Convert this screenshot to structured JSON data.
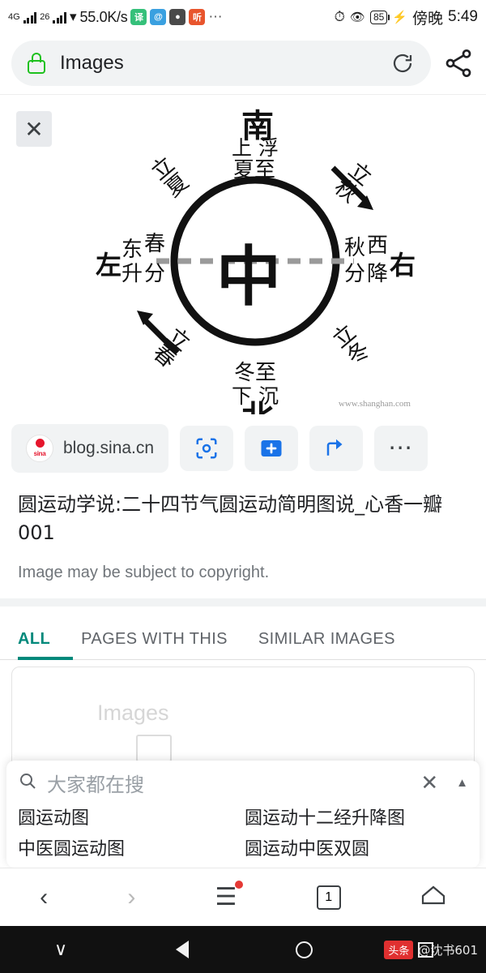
{
  "status_bar": {
    "network_1": "4G",
    "network_2": "26",
    "speed": "55.0K/s",
    "clock": "5:49",
    "clock_prefix": "傍晚",
    "battery": "85",
    "icons": [
      "signal-bars-icon",
      "signal-bars-icon",
      "wifi-icon",
      "app-icon-translate",
      "app-icon-browser",
      "app-icon-chat",
      "app-icon-media",
      "more-icon",
      "timer-icon",
      "eye-icon",
      "battery-icon",
      "charging-icon"
    ]
  },
  "browser": {
    "url_label": "Images",
    "lock_color": "#1ec11e",
    "reload_label": "reload-icon",
    "share_label": "share-icon"
  },
  "image_viewer": {
    "close_label": "✕",
    "watermark": "www.shanghan.com",
    "diagram": {
      "center": "中",
      "top": "南",
      "top_sub1": "上 浮",
      "top_sub2": "夏至",
      "bottom": "北",
      "bottom_sub1": "冬至",
      "bottom_sub2": "下 沉",
      "left": "左",
      "left_sub1": "东",
      "left_sub2": "春",
      "left_sub3": "升",
      "left_sub4": "分",
      "right": "右",
      "right_sub1": "秋",
      "right_sub2": "西",
      "right_sub3": "分",
      "right_sub4": "降",
      "nw": "立夏",
      "ne": "立秋",
      "sw": "立春",
      "se": "立冬"
    }
  },
  "source": {
    "site": "blog.sina.cn",
    "logo_text": "sina",
    "actions": [
      "lens-icon",
      "add-icon",
      "share-icon",
      "more-icon"
    ]
  },
  "caption": {
    "title": "圆运动学说:二十四节气圆运动简明图说_心香一瓣001",
    "copyright": "Image may be subject to copyright."
  },
  "tabs": [
    {
      "label": "ALL",
      "active": true
    },
    {
      "label": "PAGES WITH THIS",
      "active": false
    },
    {
      "label": "SIMILAR IMAGES",
      "active": false
    }
  ],
  "results_placeholder": {
    "ghost_text": "Images"
  },
  "suggestions": {
    "header": "大家都在搜",
    "search_icon": "search-icon",
    "close_icon": "close-icon",
    "caret_icon": "chevron-up-icon",
    "items": [
      "圆运动图",
      "圆运动十二经升降图",
      "中医圆运动图",
      "圆运动中医双圆"
    ]
  },
  "bottom_nav": {
    "back": "‹",
    "forward": "›",
    "menu": "☰",
    "tab_count": "1",
    "home": "home-icon"
  },
  "android_nav": {
    "collapse": "∨",
    "back": "back-triangle-icon",
    "home": "home-circle-icon",
    "recents": "recents-square-icon",
    "watermark_badge": "头条",
    "watermark_name": "@沈书601"
  },
  "colors": {
    "accent": "#00897b",
    "chip_bg": "#f1f3f4",
    "text": "#202124",
    "muted": "#70757a"
  }
}
